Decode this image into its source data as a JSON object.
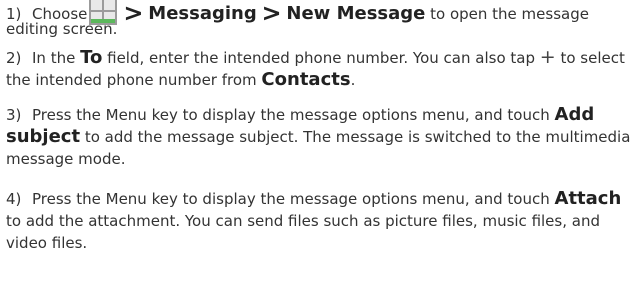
{
  "steps": [
    {
      "num": "1)",
      "choose": "Choose",
      "sep": ">",
      "messaging": "Messaging",
      "new_message": "New Message",
      "rest_line1": " to open the message",
      "rest_line2": "editing screen."
    },
    {
      "num": "2)",
      "p1": "In the ",
      "to": "To",
      "p2": " field, enter the intended phone number. You can also tap ",
      "plus": "+",
      "p3": " to select the intended phone number from ",
      "contacts": "Contacts",
      "p4": "."
    },
    {
      "num": "3)",
      "p1": "Press the Menu key  to display the message options menu, and touch ",
      "add": "Add",
      "subject": "subject",
      "p2": " to add the message subject. The message is switched to the multimedia message mode."
    },
    {
      "num": "4)",
      "p1": "Press the Menu key  to display the message options menu, and touch ",
      "attach": "Attach",
      "p2": " to add the attachment. You can send files such as picture files, music files, and video files."
    }
  ],
  "icon": "app-grid-icon",
  "colors": {
    "text": "#333333",
    "icon_tile": "#8a8a8a",
    "icon_accent": "#4caf50"
  }
}
